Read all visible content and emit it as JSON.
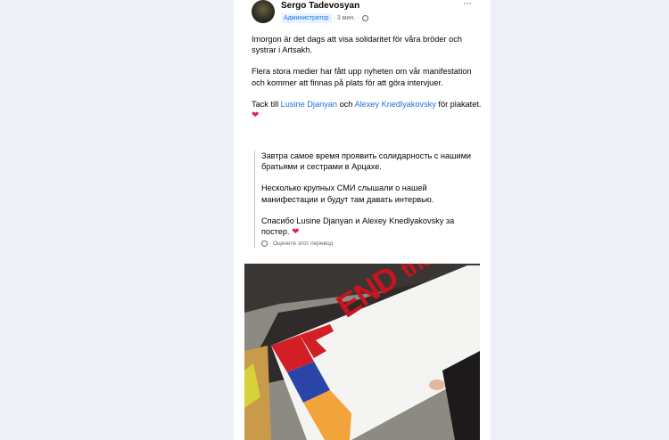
{
  "post": {
    "author": "Sergo Tadevosyan",
    "role": "Администратор",
    "time": "3 мин.",
    "more_label": "···"
  },
  "content": {
    "p1": "Imorgon är det dags att visa solidaritet för våra bröder och systrar i Artsakh.",
    "p2": "Flera stora medier har fått upp nyheten om vår manifestation och kommer att finnas på plats för att göra intervjuer.",
    "p3_prefix": "Tack till ",
    "p3_link1": "Lusine Djanyan",
    "p3_mid": " och ",
    "p3_link2": "Alexey Knedlyakovsky",
    "p3_suffix": " för plakatet. ",
    "heart": "❤"
  },
  "translation": {
    "p1": "Завтра самое время проявить солидарность с нашими братьями и сестрами в Арцахе.",
    "p2": "Несколько крупных СМИ слышали о нашей манифестации и будут там давать интервью.",
    "p3": "Спасибо Lusine Djanyan и Alexey Knedlyakovsky за постер. ",
    "heart": "❤",
    "rate_label": "· Оцените этот перевод"
  },
  "photo": {
    "banner_text": "END",
    "banner_text_small": "the BL"
  },
  "colors": {
    "link": "#216fdb",
    "badge_bg": "#e7f3ff",
    "badge_text": "#1b74e4",
    "heart": "#e0245e",
    "banner_red": "#c8141e",
    "flag_red": "#d21f26",
    "flag_blue": "#2a44a8",
    "flag_orange": "#f2a43a"
  },
  "icons": {
    "globe": "globe-icon",
    "more": "more-icon",
    "gear": "gear-icon",
    "heart": "heart-icon"
  }
}
